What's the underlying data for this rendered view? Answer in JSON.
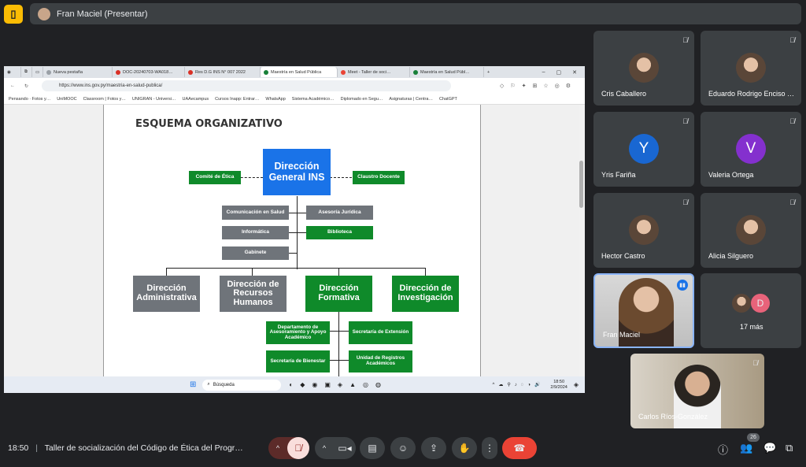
{
  "meet": {
    "presenter_label": "Fran Maciel (Presentar)",
    "time": "18:50",
    "meeting_title": "Taller de socialización del Código de Ética del Progr…",
    "participants_count": "26"
  },
  "browser": {
    "tabs": [
      {
        "label": "Nueva pestaña",
        "color": "#9aa0a6"
      },
      {
        "label": "DOC-20240703-WA018…",
        "color": "#d93025"
      },
      {
        "label": "Res D.G INS N° 007 2022",
        "color": "#d93025"
      },
      {
        "label": "Maestría en Salud Pública",
        "color": "#188038"
      },
      {
        "label": "Meet - Taller de soci…",
        "color": "#ea4335"
      },
      {
        "label": "Maestría en Salud Públ…",
        "color": "#188038"
      }
    ],
    "url": "https://www.ins.gov.py/maestria-en-salud-publica/",
    "bookmarks": [
      "Pensando · Fotos y…",
      "UniMOOC",
      "Classroom | Fotos y…",
      "UNIGRAN - Universi…",
      "UAAecampus",
      "Cursos Inapp: Entrar…",
      "WhatsApp",
      "Sistema Académico…",
      "Diplomado en Segu…",
      "Asignaturas | Centra…",
      "ChatGPT"
    ],
    "taskbar_search": "Búsqueda",
    "taskbar_time": "18:50",
    "taskbar_date": "2/9/2024"
  },
  "doc": {
    "title": "ESQUEMA ORGANIZATIVO",
    "top_box": "Dirección General INS",
    "etica": "Comité de Ética",
    "claustro": "Claustro Docente",
    "comunicacion": "Comunicación en Salud",
    "asesoria": "Asesoría Jurídica",
    "informatica": "Informática",
    "biblioteca": "Biblioteca",
    "gabinete": "Gabinete",
    "dir_admin": "Dirección Administrativa",
    "dir_rrhh": "Dirección de Recursos Humanos",
    "dir_formativa": "Dirección Formativa",
    "dir_invest": "Dirección de Investigación",
    "depto_ases": "Departamento de Asesoramiento y Apoyo Académico",
    "sec_ext": "Secretaría de Extensión",
    "sec_bien": "Secretaría de Bienestar",
    "unidad_reg": "Unidad de Registros Académicos"
  },
  "participants": [
    {
      "name": "Cris Caballero"
    },
    {
      "name": "Eduardo Rodrigo Enciso …"
    },
    {
      "name": "Yris Fariña",
      "initial": "Y",
      "color": "#1967d2"
    },
    {
      "name": "Valeria Ortega",
      "initial": "V",
      "color": "#8430ce"
    },
    {
      "name": "Hector Castro"
    },
    {
      "name": "Alicia Silguero"
    },
    {
      "name": "Fran Maciel"
    },
    {
      "name": "17 más",
      "initial": "D",
      "color": "#e8637a"
    },
    {
      "name": "Carlos Ríos-González"
    }
  ]
}
